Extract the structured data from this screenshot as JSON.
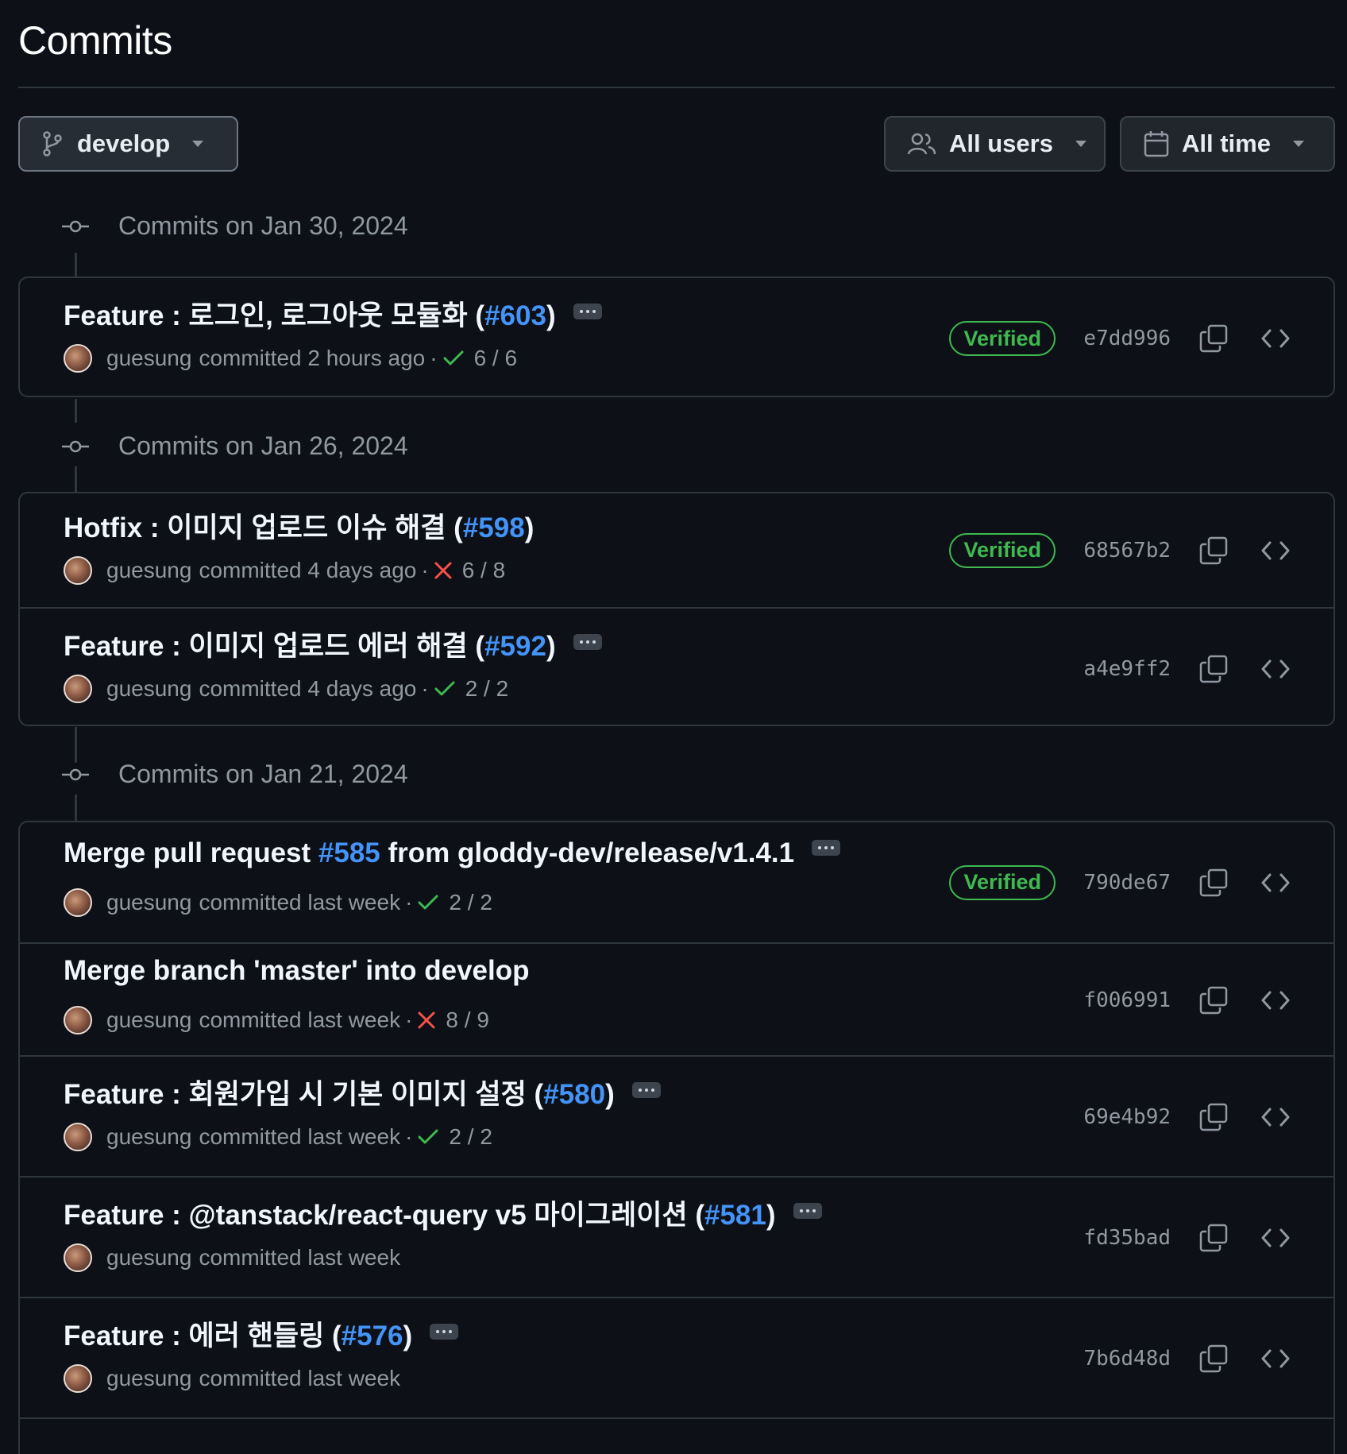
{
  "page": {
    "title": "Commits"
  },
  "toolbar": {
    "branch_label": "develop",
    "users_label": "All users",
    "time_label": "All time"
  },
  "groups": [
    {
      "header": "Commits on Jan 30, 2024",
      "commits": [
        {
          "prefix": "Feature : 로그인, 로그아웃 모듈화 (",
          "pr": "#603",
          "suffix": ")",
          "author": "guesung",
          "when": "committed 2 hours ago",
          "status": "success",
          "checks": "6 / 6",
          "verified": "Verified",
          "sha": "e7dd996"
        }
      ]
    },
    {
      "header": "Commits on Jan 26, 2024",
      "commits": [
        {
          "prefix": "Hotfix : 이미지 업로드 이슈 해결 (",
          "pr": "#598",
          "suffix": ")",
          "author": "guesung",
          "when": "committed 4 days ago",
          "status": "failure",
          "checks": "6 / 8",
          "verified": "Verified",
          "sha": "68567b2"
        },
        {
          "prefix": "Feature : 이미지 업로드 에러 해결 (",
          "pr": "#592",
          "suffix": ")",
          "author": "guesung",
          "when": "committed 4 days ago",
          "status": "success",
          "checks": "2 / 2",
          "verified": "",
          "sha": "a4e9ff2"
        }
      ]
    },
    {
      "header": "Commits on Jan 21, 2024",
      "commits": [
        {
          "prefix": "Merge pull request ",
          "pr": "#585",
          "suffix": " from gloddy-dev/release/v1.4.1",
          "author": "guesung",
          "when": "committed last week",
          "status": "success",
          "checks": "2 / 2",
          "verified": "Verified",
          "sha": "790de67"
        },
        {
          "prefix": "Merge branch 'master' into develop",
          "pr": "",
          "suffix": "",
          "author": "guesung",
          "when": "committed last week",
          "status": "failure",
          "checks": "8 / 9",
          "verified": "",
          "sha": "f006991"
        },
        {
          "prefix": "Feature : 회원가입 시 기본 이미지 설정 (",
          "pr": "#580",
          "suffix": ")",
          "author": "guesung",
          "when": "committed last week",
          "status": "success",
          "checks": "2 / 2",
          "verified": "",
          "sha": "69e4b92"
        },
        {
          "prefix": "Feature : @tanstack/react-query v5 마이그레이션 (",
          "pr": "#581",
          "suffix": ")",
          "author": "guesung",
          "when": "committed last week",
          "status": "",
          "checks": "",
          "verified": "",
          "sha": "fd35bad"
        },
        {
          "prefix": "Feature : 에러 핸들링 (",
          "pr": "#576",
          "suffix": ")",
          "author": "guesung",
          "when": "committed last week",
          "status": "",
          "checks": "",
          "verified": "",
          "sha": "7b6d48d"
        }
      ]
    }
  ],
  "icons": {
    "branch": "git-branch-icon",
    "users": "people-icon",
    "time": "calendar-icon",
    "node": "git-commit-icon",
    "copy": "copy-icon",
    "browse": "code-icon",
    "success": "check-icon",
    "failure": "x-icon",
    "ellipsis": "ellipsis-icon"
  },
  "colors": {
    "background": "#0d1117",
    "border": "#30363d",
    "link": "#4493f8",
    "success": "#3fb950",
    "danger": "#f85149",
    "muted": "#9198a1"
  }
}
